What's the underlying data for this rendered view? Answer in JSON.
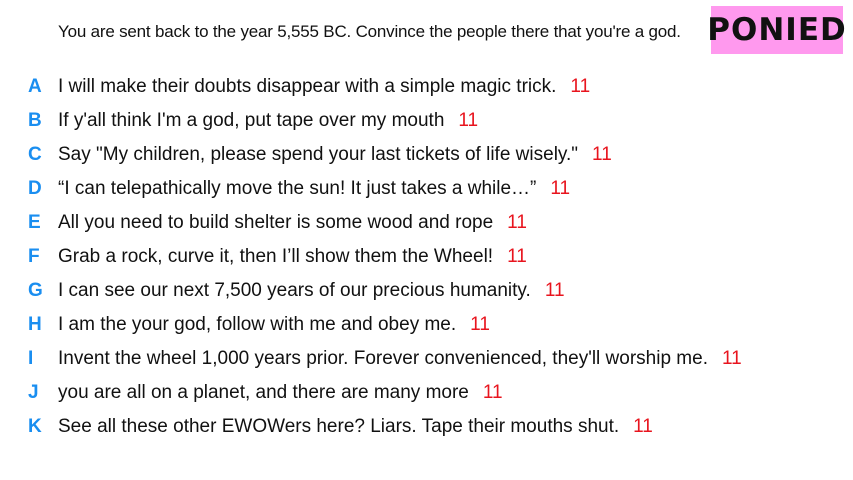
{
  "prompt": "You are sent back to the year 5,555 BC. Convince the people there that you're a god.",
  "badge": "PONIED",
  "colors": {
    "letter": "#1a8ef0",
    "score": "#e8141e",
    "badge_bg": "#ff99ee"
  },
  "responses": [
    {
      "letter": "A",
      "text": "I will make their doubts disappear with a simple magic trick.",
      "score": "11"
    },
    {
      "letter": "B",
      "text": "If y'all think I'm a god, put tape over my mouth",
      "score": "11"
    },
    {
      "letter": "C",
      "text": "Say \"My children, please spend your last tickets of life wisely.\"",
      "score": "11"
    },
    {
      "letter": "D",
      "text": "“I can telepathically move the sun! It just takes a while…”",
      "score": "11"
    },
    {
      "letter": "E",
      "text": "All you need to build shelter is some wood and rope",
      "score": "11"
    },
    {
      "letter": "F",
      "text": "Grab a rock, curve it, then I’ll show them the Wheel!",
      "score": "11"
    },
    {
      "letter": "G",
      "text": "I can see our next 7,500 years of our precious humanity.",
      "score": "11"
    },
    {
      "letter": "H",
      "text": "I am the your god, follow with me and obey me.",
      "score": "11"
    },
    {
      "letter": "I",
      "text": "Invent the wheel 1,000 years prior. Forever convenienced, they'll worship me.",
      "score": "11"
    },
    {
      "letter": "J",
      "text": "you are all on a planet, and there are many more",
      "score": "11"
    },
    {
      "letter": "K",
      "text": "See all these other EWOWers here? Liars. Tape their mouths shut.",
      "score": "11"
    }
  ]
}
